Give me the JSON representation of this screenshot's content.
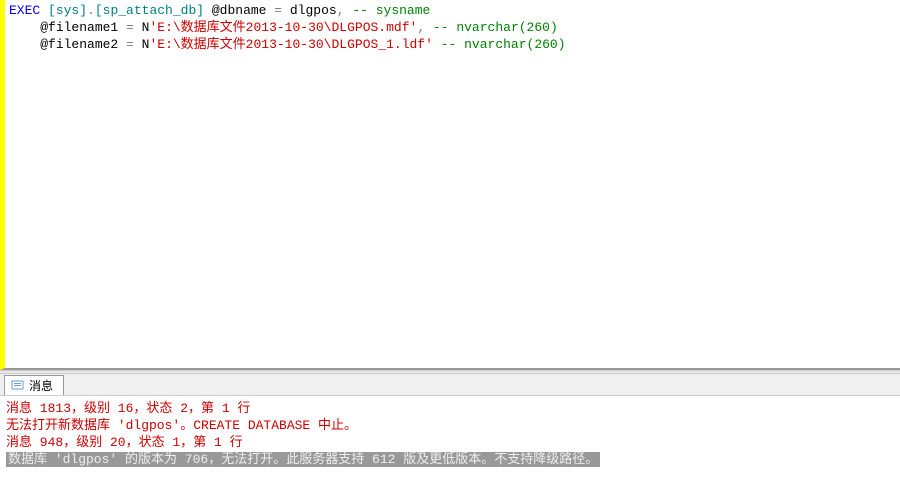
{
  "editor": {
    "line1": {
      "kw": "EXEC",
      "bracket1": " [sys]",
      "dot": ".",
      "bracket2": "[sp_attach_db]",
      "param": " @dbname ",
      "eq": "=",
      "val": " dlgpos",
      "comma": ",",
      "comment": " -- sysname"
    },
    "line2": {
      "indent": "    ",
      "param": "@filename1 ",
      "eq": "=",
      "nprefix": " N",
      "str": "'E:\\数据库文件2013-10-30\\DLGPOS.mdf'",
      "comma": ",",
      "comment": " -- nvarchar(260)"
    },
    "line3": {
      "indent": "    ",
      "param": "@filename2 ",
      "eq": "=",
      "nprefix": " N",
      "str": "'E:\\数据库文件2013-10-30\\DLGPOS_1.ldf'",
      "comment": " -- nvarchar(260)"
    }
  },
  "tab": {
    "label": "消息"
  },
  "messages": {
    "l1": "消息 1813，级别 16，状态 2，第 1 行",
    "l2": "无法打开新数据库 'dlgpos'。CREATE DATABASE 中止。",
    "l3": "消息 948，级别 20，状态 1，第 1 行",
    "l4": "数据库 'dlgpos' 的版本为 706，无法打开。此服务器支持 612 版及更低版本。不支持降级路径。"
  },
  "chart_data": null
}
